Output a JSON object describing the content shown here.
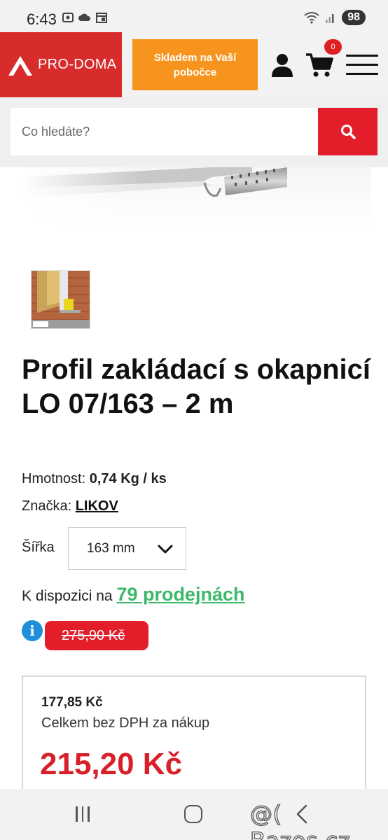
{
  "status_bar": {
    "time": "6:43",
    "battery": "98"
  },
  "header": {
    "logo_text": "PRO-DOMA",
    "store_button": "Skladem na Vaší pobočce",
    "cart_count": "0"
  },
  "search": {
    "placeholder": "Co hledáte?"
  },
  "product": {
    "title": "Profil zakládací s okapnicí LO 07/163 – 2 m",
    "weight_label": "Hmotnost:",
    "weight_value": "0,74 Kg / ks",
    "brand_label": "Značka:",
    "brand_value": "LIKOV",
    "width_label": "Šířka",
    "width_value": "163 mm",
    "availability_prefix": "K dispozici na",
    "availability_link": "79 prodejnách",
    "old_price": "275,90 Kč",
    "price_without_vat": "177,85 Kč",
    "price_without_vat_label": "Celkem bez DPH za nákup",
    "price": "215,20 Kč"
  },
  "watermark": "@( Bazos.cz",
  "colors": {
    "brand_red": "#d82c2c",
    "store_orange": "#f7941d",
    "availability_green": "#3db86b",
    "price_red": "#d8202a",
    "info_blue": "#1e8fd8"
  },
  "icons": [
    "screenshot-icon",
    "cloud-icon",
    "calendar-icon",
    "wifi-icon",
    "signal-icon",
    "user-icon",
    "cart-icon",
    "menu-icon",
    "search-icon",
    "info-icon",
    "chevron-down-icon",
    "recent-apps-icon",
    "home-icon",
    "back-icon"
  ]
}
